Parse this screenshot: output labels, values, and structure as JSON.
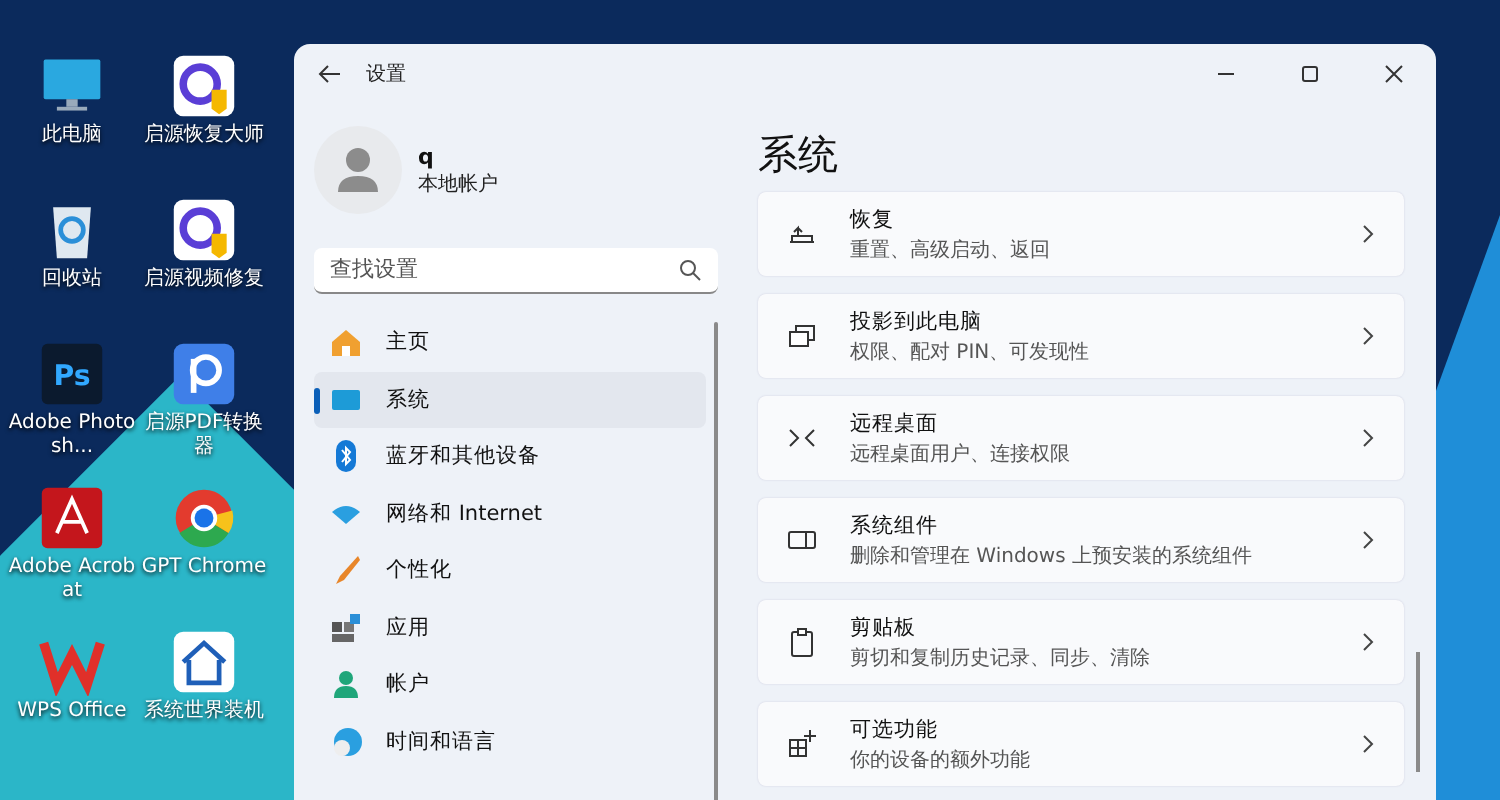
{
  "desktop": {
    "icons": [
      {
        "kind": "monitor",
        "label": "此电脑"
      },
      {
        "kind": "restore-app",
        "label": "启源恢复大师"
      },
      {
        "kind": "recycle-bin",
        "label": "回收站"
      },
      {
        "kind": "video-app",
        "label": "启源视频修复"
      },
      {
        "kind": "photoshop",
        "label": "Adobe Photosh...",
        "glyph": "Ps"
      },
      {
        "kind": "pdf-app",
        "label": "启源PDF转换器"
      },
      {
        "kind": "acrobat",
        "label": "Adobe Acrobat"
      },
      {
        "kind": "chrome",
        "label": "GPT Chrome"
      },
      {
        "kind": "wps",
        "label": "WPS Office"
      },
      {
        "kind": "house-app",
        "label": "系统世界装机"
      }
    ]
  },
  "window": {
    "title": "设置",
    "account": {
      "name": "q",
      "type": "本地帐户"
    },
    "search": {
      "placeholder": "查找设置"
    },
    "nav": [
      {
        "kind": "home",
        "label": "主页",
        "selected": false
      },
      {
        "kind": "system",
        "label": "系统",
        "selected": true
      },
      {
        "kind": "bluetooth",
        "label": "蓝牙和其他设备",
        "selected": false
      },
      {
        "kind": "network",
        "label": "网络和 Internet",
        "selected": false
      },
      {
        "kind": "brush",
        "label": "个性化",
        "selected": false
      },
      {
        "kind": "apps",
        "label": "应用",
        "selected": false
      },
      {
        "kind": "account",
        "label": "帐户",
        "selected": false
      },
      {
        "kind": "time",
        "label": "时间和语言",
        "selected": false
      }
    ],
    "page_title": "系统",
    "cards": [
      {
        "kind": "recovery",
        "title": "恢复",
        "subtitle": "重置、高级启动、返回"
      },
      {
        "kind": "project",
        "title": "投影到此电脑",
        "subtitle": "权限、配对 PIN、可发现性"
      },
      {
        "kind": "remote",
        "title": "远程桌面",
        "subtitle": "远程桌面用户、连接权限"
      },
      {
        "kind": "component",
        "title": "系统组件",
        "subtitle": "删除和管理在 Windows 上预安装的系统组件"
      },
      {
        "kind": "clipboard",
        "title": "剪贴板",
        "subtitle": "剪切和复制历史记录、同步、清除"
      },
      {
        "kind": "optional",
        "title": "可选功能",
        "subtitle": "你的设备的额外功能"
      }
    ]
  }
}
